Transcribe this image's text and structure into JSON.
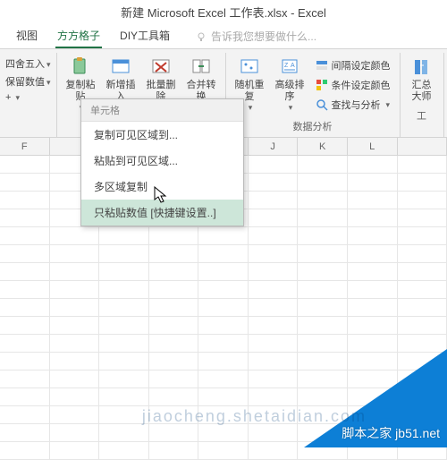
{
  "window": {
    "title": "新建 Microsoft Excel 工作表.xlsx - Excel"
  },
  "tabs": {
    "view": "视图",
    "fgz": "方方格子",
    "diy": "DIY工具箱",
    "hint": "告诉我您想要做什么..."
  },
  "left_group": {
    "l1": "四舍五入",
    "l2": "保留数值",
    "l3": "+"
  },
  "ribbon": {
    "copy_paste": "复制粘\n贴",
    "insert": "新增插\n入",
    "batch_del": "批量删\n除",
    "merge": "合并转\n换",
    "random": "随机重\n复",
    "sort": "高级排\n序",
    "interval_color": "间隔设定颜色",
    "cond_color": "条件设定颜色",
    "check": "查找与分析",
    "summary": "汇总\n大师",
    "group_data": "数据分析",
    "group_tools": "工"
  },
  "dropdown": {
    "header": "单元格",
    "items": [
      "复制可见区域到...",
      "粘贴到可见区域...",
      "多区域复制",
      "只粘贴数值  [快捷键设置..]"
    ]
  },
  "columns": [
    "F",
    "",
    "",
    "",
    "",
    "J",
    "K",
    "L",
    ""
  ],
  "watermark": {
    "main": "脚本之家 jb51.net",
    "sub": "jiaocheng.shetaidian.com"
  }
}
